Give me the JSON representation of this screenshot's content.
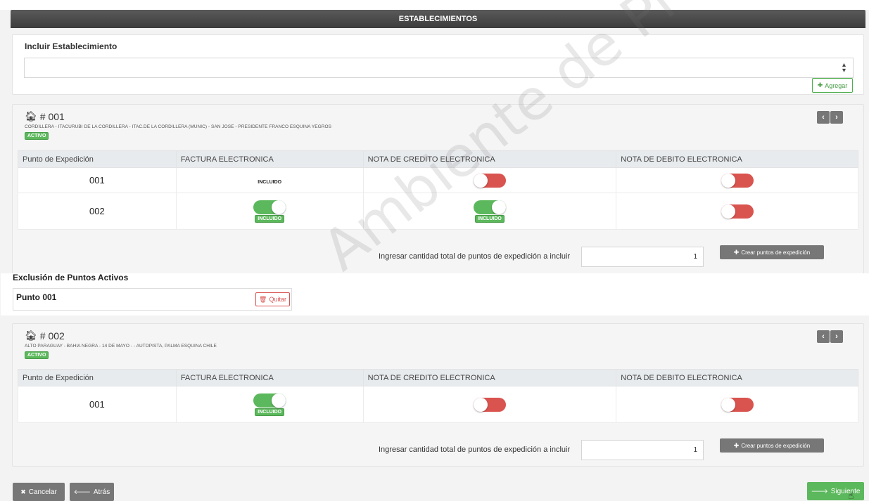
{
  "header": {
    "title": "ESTABLECIMIENTOS"
  },
  "incluir": {
    "title": "Incluir Establecimiento",
    "select_value": "",
    "add_label": "Agregar"
  },
  "columns": [
    "Punto de Expedición",
    "FACTURA ELECTRONICA",
    "NOTA DE CREDITO ELECTRONICA",
    "NOTA DE DEBITO ELECTRONICA"
  ],
  "establishments": [
    {
      "number": "# 001",
      "address": "CORDILLERA - ITACURUBI DE LA CORDILLERA - ITAC.DE LA CORDILLERA (MUNIC) - SAN JOSE - PRESIDENTE FRANCO ESQUINA YEGROS",
      "status": "ACTIVO",
      "rows": [
        {
          "punto": "001",
          "factura": "INCLUIDO"
        },
        {
          "punto": "002"
        }
      ],
      "quantity_label": "Ingresar cantidad total de puntos de expedición a incluir",
      "quantity_value": "1",
      "create_label": "Crear puntos de expedición",
      "exclusion": {
        "title": "Exclusión de Puntos Activos",
        "items": [
          {
            "label": "Punto 001",
            "remove_label": "Quitar"
          }
        ]
      }
    },
    {
      "number": "# 002",
      "address": "ALTO PARAGUAY - BAHIA NEGRA - 14 DE MAYO - - AUTOPISTA, PALMA ESQUINA CHILE",
      "status": "ACTIVO",
      "rows": [
        {
          "punto": "001"
        }
      ],
      "quantity_label": "Ingresar cantidad total de puntos de expedición a incluir",
      "quantity_value": "1",
      "create_label": "Crear puntos de expedición"
    }
  ],
  "toggle_labels": {
    "included": "INCLUIDO"
  },
  "footer": {
    "cancel_label": "Cancelar",
    "back_label": "Atrás",
    "next_label": "Siguiente"
  },
  "watermark": "Ambiente de Pruebas",
  "colors": {
    "accent_green": "#5cb85c",
    "toggle_off": "#d9534f",
    "header": "#3c3c3c",
    "secondary_btn": "#777777"
  },
  "icons": {
    "home": "home-icon",
    "plus": "plus-icon",
    "trash": "trash-icon",
    "times": "times-icon",
    "arrow_left": "arrow-left-icon",
    "arrow_right": "arrow-right-icon"
  }
}
